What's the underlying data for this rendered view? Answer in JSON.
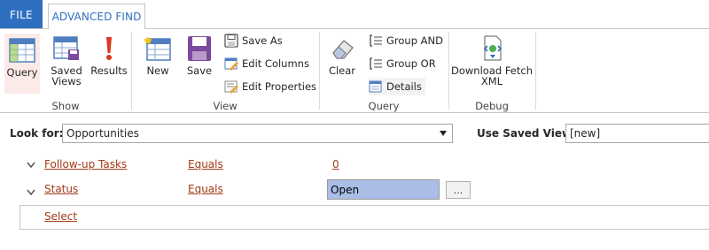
{
  "tabs": {
    "file": "FILE",
    "advanced_find": "ADVANCED FIND"
  },
  "ribbon": {
    "show_group": {
      "label": "Show",
      "query": "Query",
      "saved_views_line1": "Saved",
      "saved_views_line2": "Views",
      "results": "Results"
    },
    "view_group": {
      "label": "View",
      "new": "New",
      "save": "Save",
      "save_as": "Save As",
      "edit_columns": "Edit Columns",
      "edit_properties": "Edit Properties"
    },
    "query_group": {
      "label": "Query",
      "clear": "Clear",
      "group_and": "Group AND",
      "group_or": "Group OR",
      "details": "Details"
    },
    "debug_group": {
      "label": "Debug",
      "download_line1": "Download Fetch",
      "download_line2": "XML"
    }
  },
  "lookup": {
    "look_for_label": "Look for:",
    "look_for_value": "Opportunities",
    "saved_view_label": "Use Saved View:",
    "saved_view_value": "[new]"
  },
  "conditions": [
    {
      "field": "Follow-up Tasks",
      "operator": "Equals",
      "value": "0"
    },
    {
      "field": "Status",
      "operator": "Equals",
      "value": "Open",
      "button": "..."
    }
  ],
  "select_link": "Select",
  "colors": {
    "accent_blue": "#2f6fc0",
    "link_rust": "#a33a16",
    "selected_value_bg": "#a9bde6"
  }
}
